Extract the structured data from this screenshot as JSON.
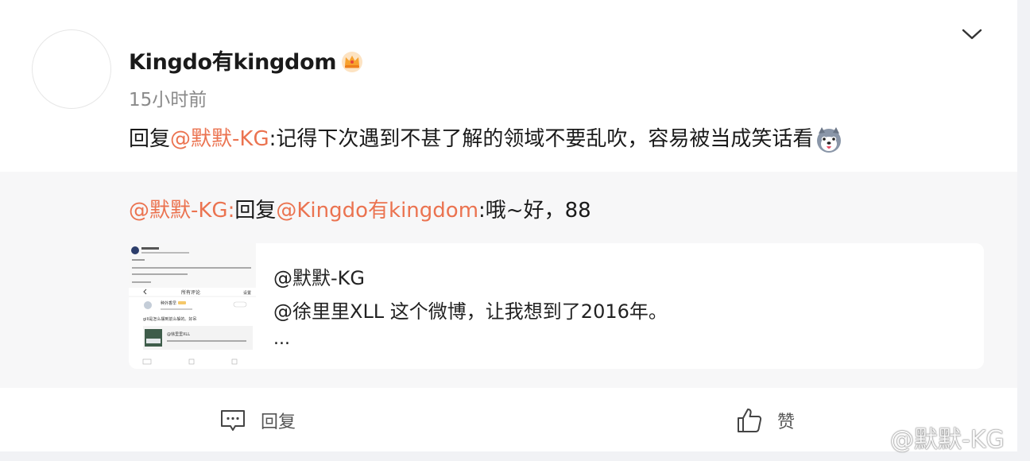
{
  "post": {
    "username": "Kingdo有kingdom",
    "crown_icon": "crown-icon",
    "timestamp": "15小时前",
    "reply_prefix": "回复",
    "mention": "@默默-KG",
    "body": ":记得下次遇到不甚了解的领域不要乱吹，容易被当成笑话看",
    "emoji_icon": "husky-emoji-icon"
  },
  "quoted": {
    "author_mention": "@默默-KG:",
    "reply_word": "回复",
    "target_mention": "@Kingdo有kingdom",
    "text": ":哦~好，88",
    "embed": {
      "user": "@默默-KG",
      "line": "@徐里里XLL 这个微博，让我想到了2016年。",
      "more": "...",
      "thumbnail": {
        "header": "所有评论",
        "settings": "设置",
        "commenter": "种外香早",
        "comment": "gill是怎么摆到前么躲的。好吊",
        "quote_user": "@徐里里XLL"
      }
    }
  },
  "actions": {
    "reply_label": "回复",
    "like_label": "赞"
  },
  "watermark": "@默默-KG",
  "colors": {
    "link": "#eb7350",
    "quoted_bg": "#f7f7f8",
    "page_bg": "#f1f2f5"
  }
}
